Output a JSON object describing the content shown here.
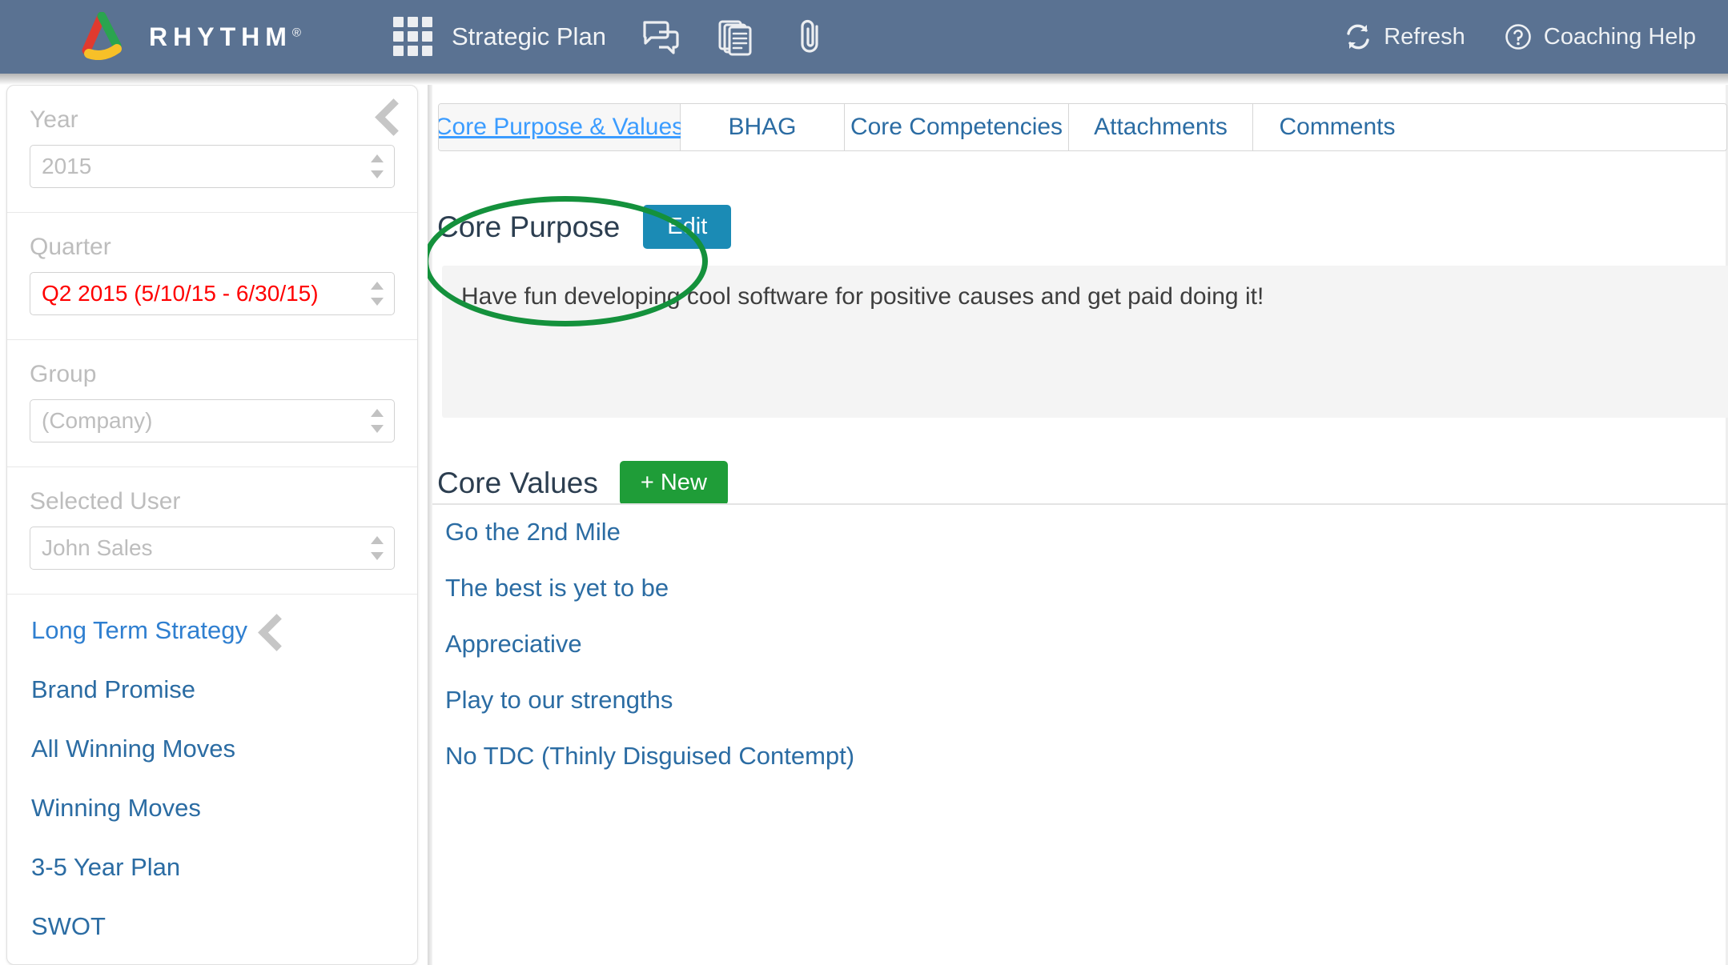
{
  "header": {
    "brand_name": "RHYTHM",
    "brand_registered": "®",
    "logo_icon": "rhythm-triangle-logo",
    "app_switcher_icon": "grid-apps-icon",
    "app_label": "Strategic Plan",
    "icons": [
      {
        "name": "chat-bubbles-icon",
        "label": "Discussions"
      },
      {
        "name": "documents-stack-icon",
        "label": "Documents"
      },
      {
        "name": "paperclip-icon",
        "label": "Attachments"
      }
    ],
    "refresh_label": "Refresh",
    "refresh_icon": "refresh-icon",
    "help_label": "Coaching Help",
    "help_icon": "question-circle-icon",
    "bg_color": "#5a7292"
  },
  "sidebar": {
    "collapse_icon": "chevron-left-icon",
    "filters": [
      {
        "label": "Year",
        "value": "2015",
        "value_color": "#bdbdbd",
        "icon": "stepper-icon"
      },
      {
        "label": "Quarter",
        "value": "Q2 2015 (5/10/15 - 6/30/15)",
        "value_color": "#ff0000",
        "icon": "stepper-icon"
      },
      {
        "label": "Group",
        "value": "(Company)",
        "value_color": "#bdbdbd",
        "icon": "stepper-icon"
      },
      {
        "label": "Selected User",
        "value": "John Sales",
        "value_color": "#bdbdbd",
        "icon": "stepper-icon"
      }
    ],
    "nav_items": [
      {
        "label": "Long Term Strategy",
        "has_chevron": true,
        "style": "light"
      },
      {
        "label": "Brand Promise",
        "has_chevron": false,
        "style": "dark"
      },
      {
        "label": "All Winning Moves",
        "has_chevron": false,
        "style": "dark"
      },
      {
        "label": "Winning Moves",
        "has_chevron": false,
        "style": "dark"
      },
      {
        "label": "3-5 Year Plan",
        "has_chevron": false,
        "style": "dark"
      },
      {
        "label": "SWOT",
        "has_chevron": false,
        "style": "dark"
      }
    ]
  },
  "main": {
    "tabs": [
      {
        "label": "Core Purpose & Values",
        "active": true
      },
      {
        "label": "BHAG",
        "active": false
      },
      {
        "label": "Core Competencies",
        "active": false
      },
      {
        "label": "Attachments",
        "active": false
      },
      {
        "label": "Comments",
        "active": false
      }
    ],
    "core_purpose": {
      "title": "Core Purpose",
      "edit_label": "Edit",
      "edit_color": "#1b8bb5",
      "text": "Have fun developing cool software for positive causes and get paid doing it!"
    },
    "core_values": {
      "title": "Core Values",
      "new_label": "+ New",
      "new_color": "#1f9d38",
      "items": [
        "Go the 2nd Mile",
        "The best is yet to be",
        "Appreciative",
        "Play to our strengths",
        "No TDC (Thinly Disguised Contempt)"
      ]
    },
    "annotation": {
      "shape": "ellipse",
      "color": "#14913c",
      "targets": "Core Purpose"
    }
  }
}
